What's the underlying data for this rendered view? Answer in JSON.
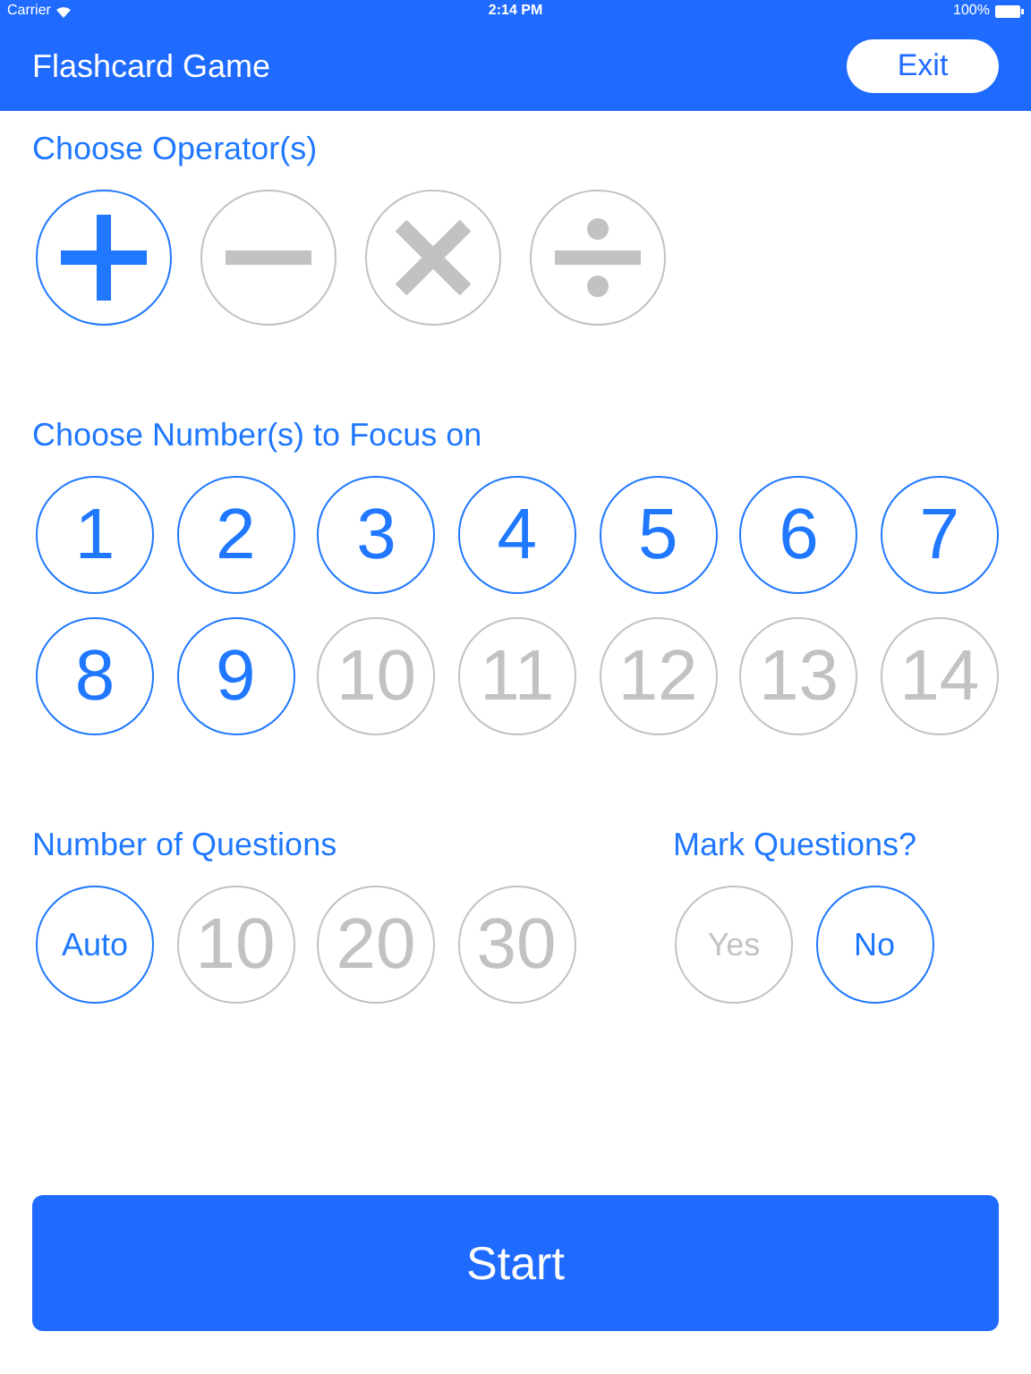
{
  "status_bar": {
    "carrier": "Carrier",
    "time": "2:14 PM",
    "battery": "100%"
  },
  "nav": {
    "title": "Flashcard Game",
    "exit": "Exit"
  },
  "operators": {
    "title": "Choose Operator(s)",
    "items": [
      {
        "kind": "plus",
        "selected": true
      },
      {
        "kind": "minus",
        "selected": false
      },
      {
        "kind": "times",
        "selected": false
      },
      {
        "kind": "divide",
        "selected": false
      }
    ]
  },
  "numbers": {
    "title": "Choose Number(s) to Focus on",
    "items": [
      {
        "label": "1",
        "selected": true
      },
      {
        "label": "2",
        "selected": true
      },
      {
        "label": "3",
        "selected": true
      },
      {
        "label": "4",
        "selected": true
      },
      {
        "label": "5",
        "selected": true
      },
      {
        "label": "6",
        "selected": true
      },
      {
        "label": "7",
        "selected": true
      },
      {
        "label": "8",
        "selected": true
      },
      {
        "label": "9",
        "selected": true
      },
      {
        "label": "10",
        "selected": false
      },
      {
        "label": "11",
        "selected": false
      },
      {
        "label": "12",
        "selected": false
      },
      {
        "label": "13",
        "selected": false
      },
      {
        "label": "14",
        "selected": false
      }
    ]
  },
  "question_count": {
    "title": "Number of Questions",
    "items": [
      {
        "label": "Auto",
        "selected": true
      },
      {
        "label": "10",
        "selected": false
      },
      {
        "label": "20",
        "selected": false
      },
      {
        "label": "30",
        "selected": false
      }
    ]
  },
  "mark_questions": {
    "title": "Mark Questions?",
    "items": [
      {
        "label": "Yes",
        "selected": false
      },
      {
        "label": "No",
        "selected": true
      }
    ]
  },
  "start": "Start"
}
